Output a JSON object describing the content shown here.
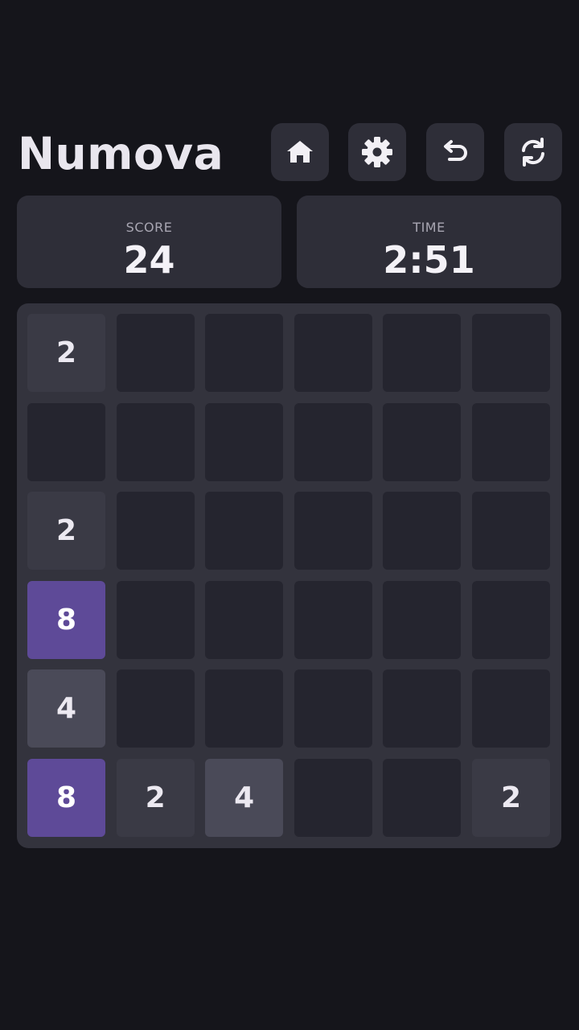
{
  "app": {
    "title": "Numova"
  },
  "toolbar": {
    "buttons": [
      {
        "name": "home-button",
        "icon": "home-icon"
      },
      {
        "name": "settings-button",
        "icon": "gear-icon"
      },
      {
        "name": "undo-button",
        "icon": "undo-icon"
      },
      {
        "name": "restart-button",
        "icon": "refresh-icon"
      }
    ]
  },
  "stats": {
    "score_label": "SCORE",
    "score_value": "24",
    "time_label": "TIME",
    "time_value": "2:51"
  },
  "board": {
    "size": 6,
    "grid": [
      [
        "2",
        "",
        "",
        "",
        "",
        ""
      ],
      [
        "",
        "",
        "",
        "",
        "",
        ""
      ],
      [
        "2",
        "",
        "",
        "",
        "",
        ""
      ],
      [
        "8",
        "",
        "",
        "",
        "",
        ""
      ],
      [
        "4",
        "",
        "",
        "",
        "",
        ""
      ],
      [
        "8",
        "2",
        "4",
        "",
        "",
        "2"
      ]
    ]
  },
  "colors": {
    "background": "#15151b",
    "panel": "#2e2e38",
    "board": "#33333d",
    "empty_cell": "#25252f",
    "tile_2": "#3a3a45",
    "tile_4": "#4a4a58",
    "tile_8": "#5e4a98",
    "text": "#ece9f1"
  }
}
